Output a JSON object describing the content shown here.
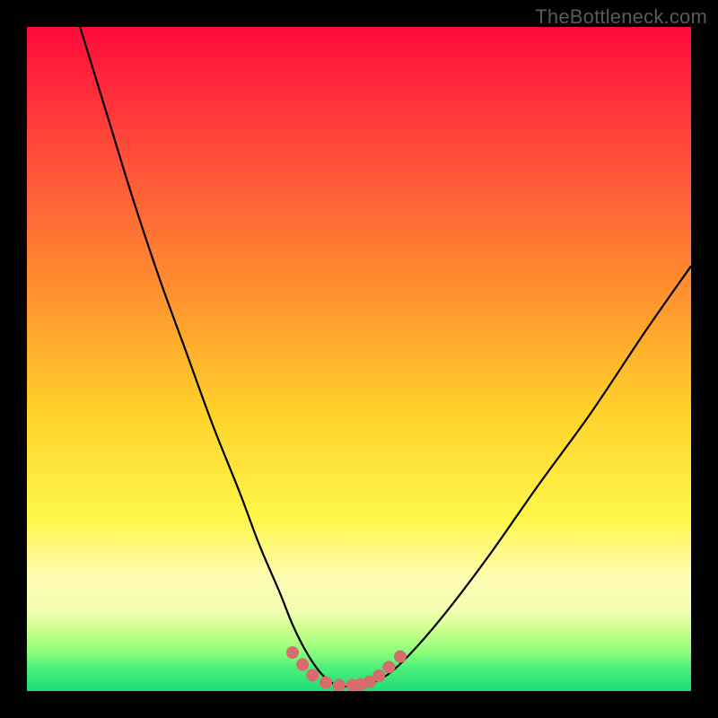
{
  "watermark": "TheBottleneck.com",
  "colors": {
    "frame": "#000000",
    "curve_stroke": "#000000",
    "marker_fill": "#d86b6b",
    "marker_stroke": "#b85454",
    "gradient_stops": [
      {
        "offset": 0.0,
        "color": "#ff0a3a"
      },
      {
        "offset": 0.18,
        "color": "#ff4a3a"
      },
      {
        "offset": 0.38,
        "color": "#ff8a2f"
      },
      {
        "offset": 0.58,
        "color": "#ffd22a"
      },
      {
        "offset": 0.74,
        "color": "#fff74a"
      },
      {
        "offset": 0.83,
        "color": "#fffcb4"
      },
      {
        "offset": 0.88,
        "color": "#f1ffb0"
      },
      {
        "offset": 0.91,
        "color": "#c8ff8a"
      },
      {
        "offset": 0.94,
        "color": "#8fff7a"
      },
      {
        "offset": 0.965,
        "color": "#4cf07a"
      },
      {
        "offset": 1.0,
        "color": "#1fdc74"
      }
    ]
  },
  "chart_data": {
    "type": "line",
    "title": "",
    "xlabel": "",
    "ylabel": "",
    "xlim": [
      0,
      100
    ],
    "ylim": [
      0,
      100
    ],
    "series": [
      {
        "name": "bottleneck-curve",
        "x": [
          8,
          12,
          16,
          20,
          24,
          28,
          32,
          35,
          38,
          40,
          42,
          44,
          46,
          48,
          50,
          52,
          55,
          59,
          64,
          70,
          77,
          85,
          93,
          100
        ],
        "y": [
          100,
          87,
          74,
          62,
          51,
          40,
          30,
          22,
          15,
          10,
          6,
          3,
          1.2,
          0.7,
          0.7,
          1.2,
          3,
          7,
          13,
          21,
          31,
          42,
          54,
          64
        ]
      }
    ],
    "markers": {
      "name": "highlight-points",
      "x": [
        40,
        41.5,
        43,
        45,
        47,
        49,
        50.2,
        51.6,
        53,
        54.5,
        56.2
      ],
      "y": [
        5.8,
        4.0,
        2.4,
        1.3,
        0.9,
        0.9,
        1.0,
        1.4,
        2.3,
        3.6,
        5.2
      ]
    }
  }
}
